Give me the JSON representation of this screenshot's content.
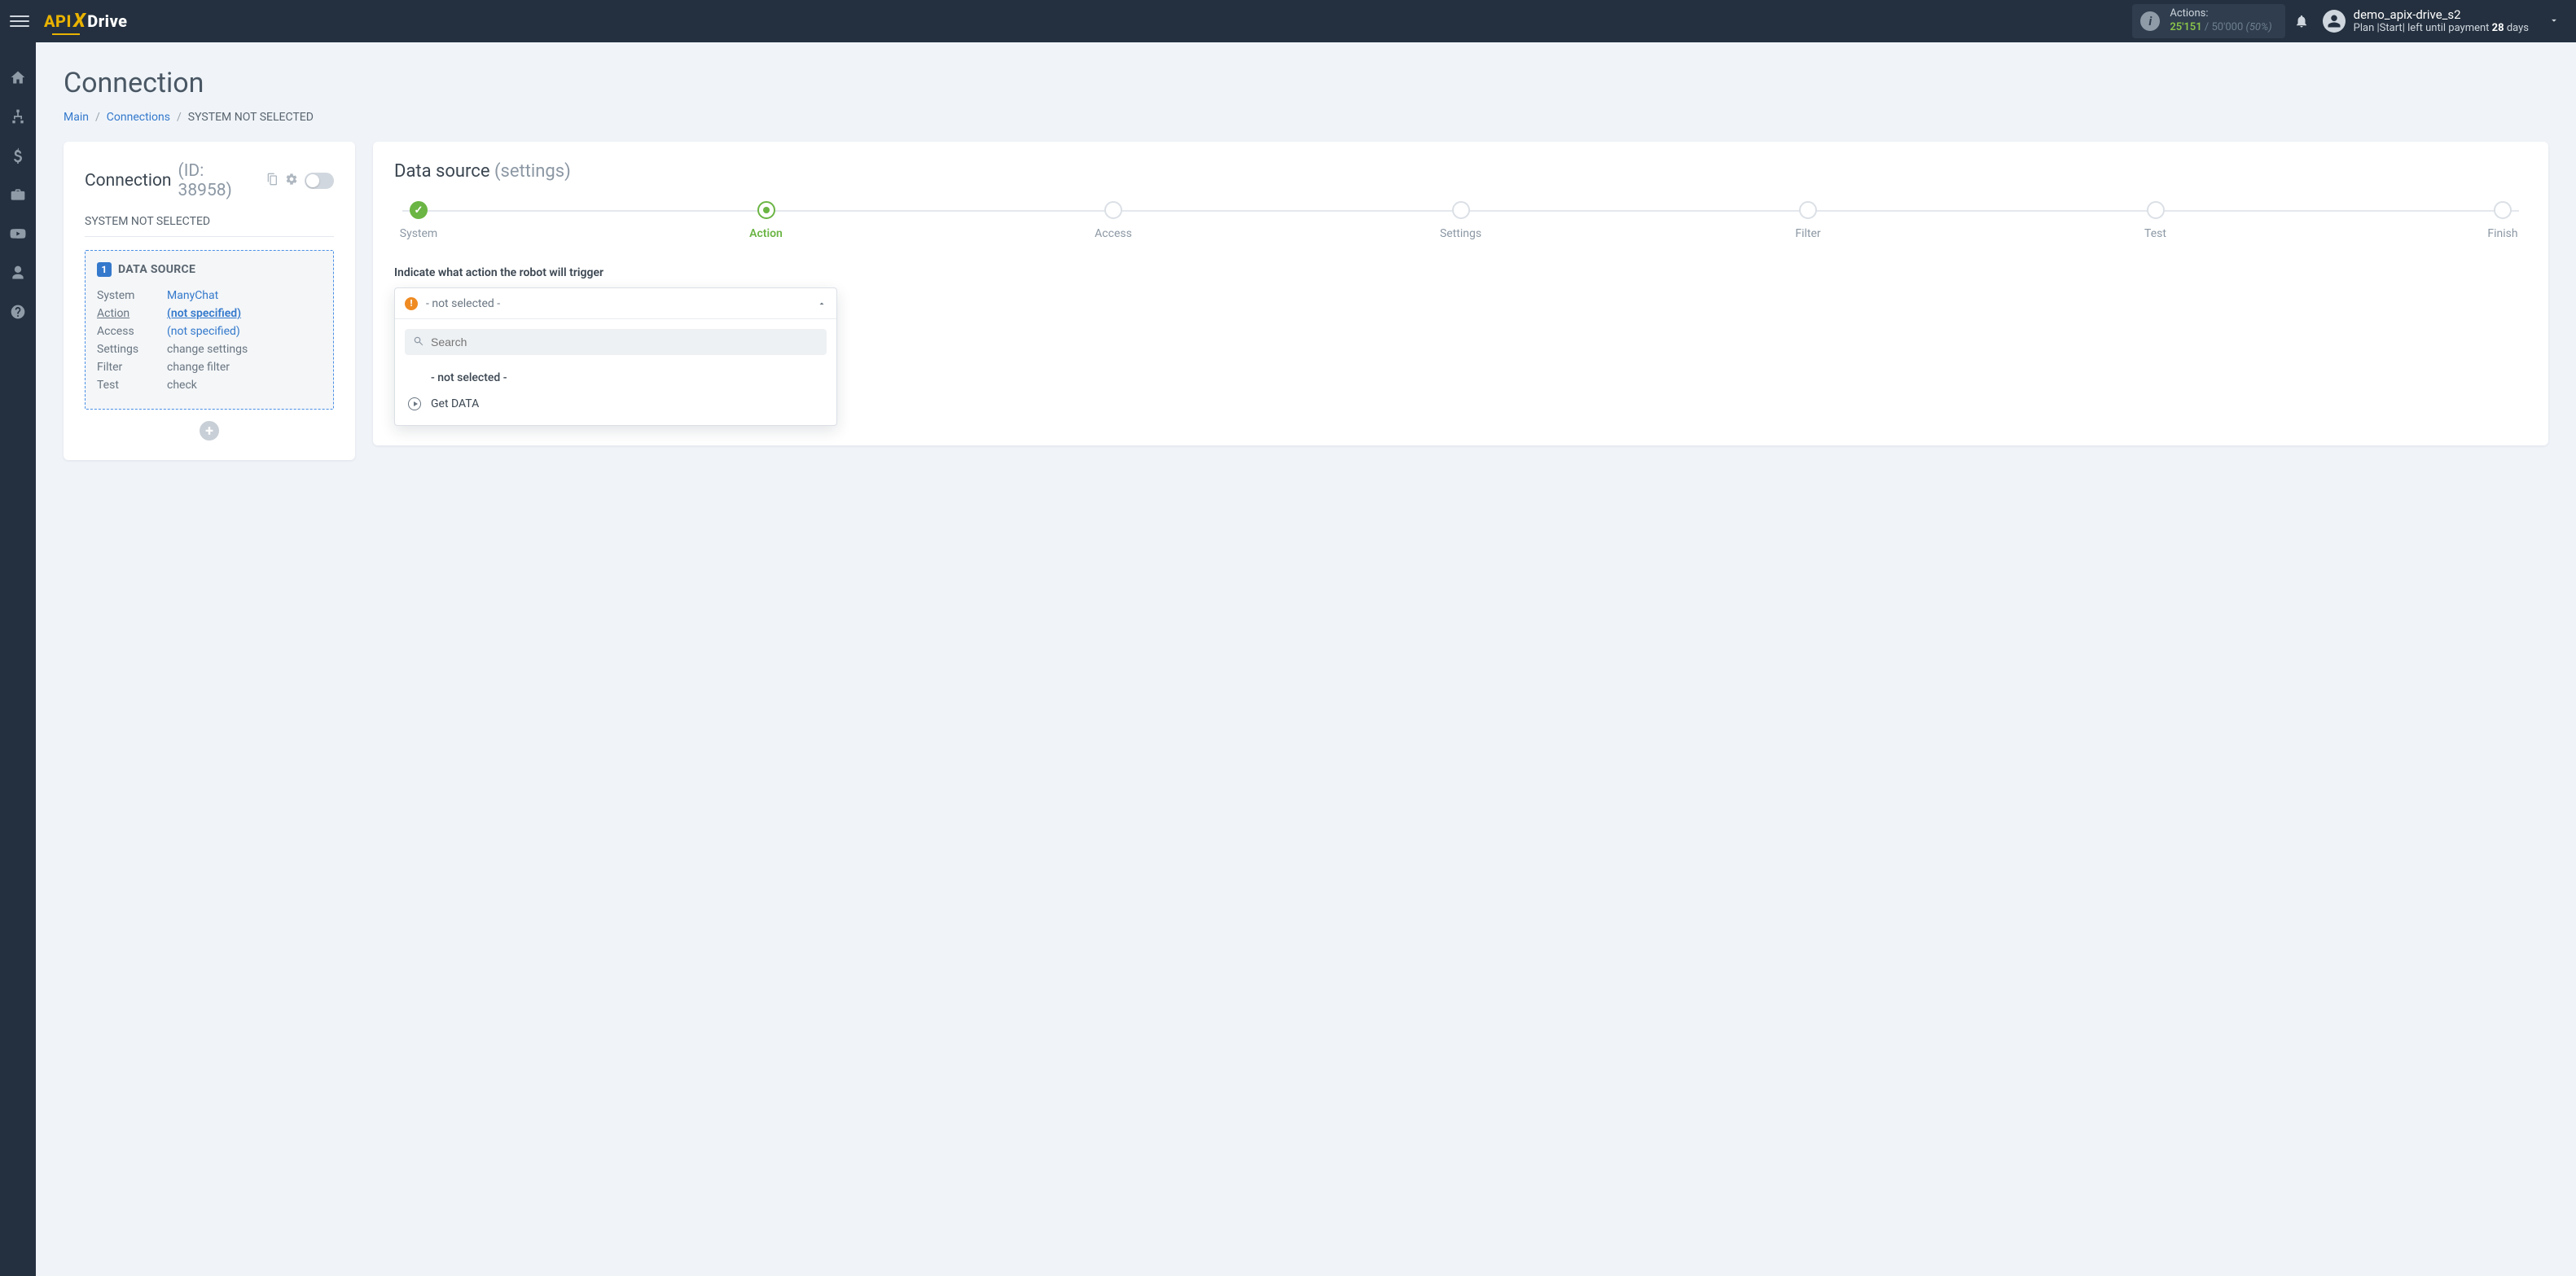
{
  "topbar": {
    "logo": {
      "p1": "API",
      "x": "X",
      "p2": "Drive"
    },
    "actions": {
      "label": "Actions:",
      "used": "25'151",
      "sep": " / ",
      "total": "50'000",
      "pct": "(50%)"
    },
    "user": {
      "name": "demo_apix-drive_s2",
      "plan_prefix": "Plan |",
      "plan_name": "Start",
      "plan_mid": "| left until payment ",
      "plan_days_bold": "28",
      "plan_suffix": " days"
    }
  },
  "page": {
    "title": "Connection",
    "breadcrumb": {
      "main": "Main",
      "connections": "Connections",
      "current": "SYSTEM NOT SELECTED"
    }
  },
  "left_card": {
    "title": "Connection",
    "id_label": "(ID: 38958)",
    "subtitle": "SYSTEM NOT SELECTED",
    "ds_badge": "1",
    "ds_title": "DATA SOURCE",
    "rows": {
      "system": {
        "k": "System",
        "v": "ManyChat"
      },
      "action": {
        "k": "Action",
        "v": "(not specified)"
      },
      "access": {
        "k": "Access",
        "v": "(not specified)"
      },
      "settings": {
        "k": "Settings",
        "v": "change settings"
      },
      "filter": {
        "k": "Filter",
        "v": "change filter"
      },
      "test": {
        "k": "Test",
        "v": "check"
      }
    }
  },
  "right_card": {
    "title": "Data source",
    "title_muted": "(settings)",
    "steps": [
      "System",
      "Action",
      "Access",
      "Settings",
      "Filter",
      "Test",
      "Finish"
    ],
    "field_label": "Indicate what action the robot will trigger",
    "dropdown": {
      "selected": "- not selected -",
      "placeholder": "Search",
      "opt_notselected": "- not selected -",
      "opt_getdata": "Get DATA"
    }
  }
}
